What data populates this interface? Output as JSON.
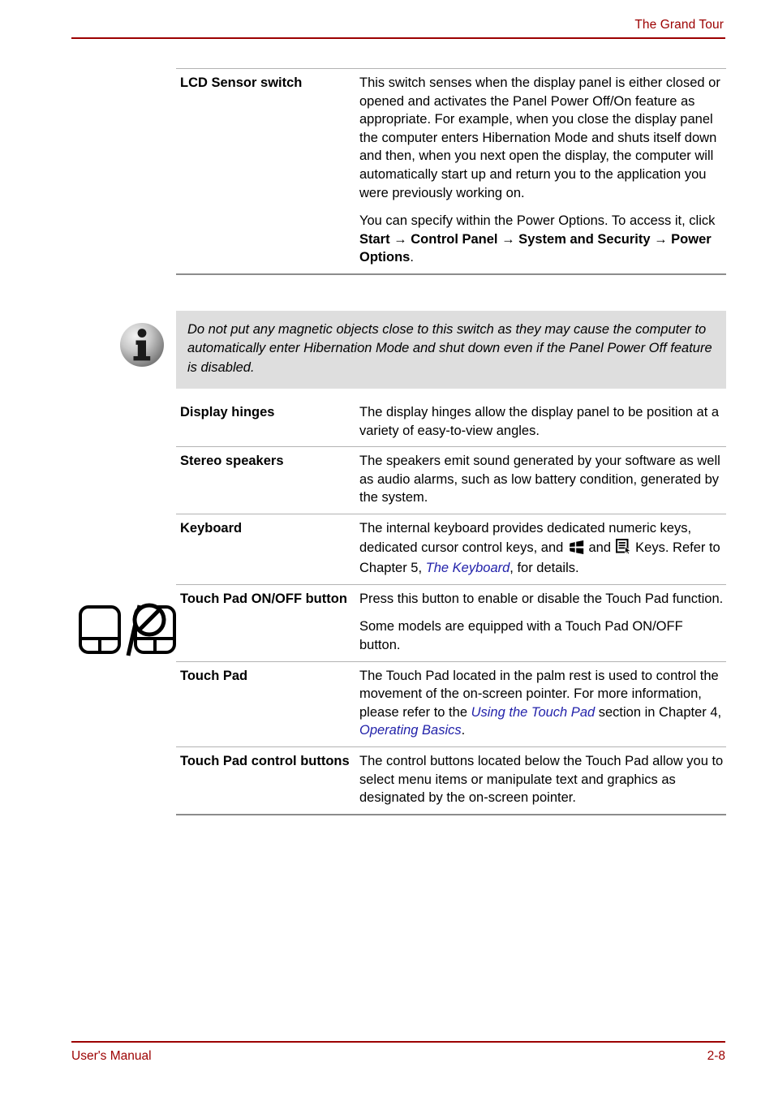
{
  "header": {
    "title": "The Grand Tour"
  },
  "footer": {
    "manual_label": "User's Manual",
    "page_number": "2-8"
  },
  "colors": {
    "accent_red": "#9c0000",
    "link_blue": "#2222aa",
    "note_background": "#dedede",
    "rule_gray": "#b3b3b3"
  },
  "table": {
    "rows": [
      {
        "term": "LCD Sensor switch",
        "paragraphs": [
          {
            "segments": [
              {
                "text": "This switch senses when the display panel is either closed or opened and activates the Panel Power Off/On feature as appropriate. For example, when you close the display panel the computer enters Hibernation Mode and shuts itself down and then, when you next open the display, the computer will automatically start up and return you to the application you were previously working on.",
                "style": "normal"
              }
            ]
          },
          {
            "segments": [
              {
                "text": "You can specify within the Power Options. To access it, click ",
                "style": "normal"
              },
              {
                "text": "Start → Control Panel → System and Security → Power Options",
                "style": "bold"
              },
              {
                "text": ".",
                "style": "normal"
              }
            ]
          }
        ]
      },
      {
        "term": "Display hinges",
        "paragraphs": [
          {
            "segments": [
              {
                "text": "The display hinges allow the display panel to be position at a variety of easy-to-view angles.",
                "style": "normal"
              }
            ]
          }
        ]
      },
      {
        "term": "Stereo speakers",
        "paragraphs": [
          {
            "segments": [
              {
                "text": "The speakers emit sound generated by your software as well as audio alarms, such as low battery condition, generated by the system.",
                "style": "normal"
              }
            ]
          }
        ]
      },
      {
        "term": "Keyboard",
        "paragraphs": [
          {
            "segments": [
              {
                "text": "The internal keyboard provides dedicated numeric keys, dedicated cursor control keys, and ",
                "style": "normal"
              },
              {
                "text": "",
                "style": "icon",
                "icon": "windows-key-icon"
              },
              {
                "text": " and ",
                "style": "normal"
              },
              {
                "text": "",
                "style": "icon",
                "icon": "application-key-icon"
              },
              {
                "text": "  Keys. Refer to Chapter 5, ",
                "style": "normal"
              },
              {
                "text": "The Keyboard",
                "style": "link"
              },
              {
                "text": ", for details.",
                "style": "normal"
              }
            ]
          }
        ]
      },
      {
        "term": "Touch Pad ON/OFF button",
        "margin_icon": "touchpad-on-off-icon",
        "paragraphs": [
          {
            "segments": [
              {
                "text": "Press this button to enable or disable the Touch Pad function.",
                "style": "normal"
              }
            ]
          },
          {
            "segments": [
              {
                "text": "Some models are equipped with a Touch Pad ON/OFF button.",
                "style": "normal"
              }
            ]
          }
        ]
      },
      {
        "term": "Touch Pad",
        "paragraphs": [
          {
            "segments": [
              {
                "text": "The Touch Pad located in the palm rest is used to control the movement of the on-screen pointer. For more information, please refer to the ",
                "style": "normal"
              },
              {
                "text": "Using the Touch Pad",
                "style": "link"
              },
              {
                "text": " section in Chapter 4, ",
                "style": "normal"
              },
              {
                "text": "Operating Basics",
                "style": "link"
              },
              {
                "text": ".",
                "style": "normal"
              }
            ]
          }
        ]
      },
      {
        "term": "Touch Pad control buttons",
        "paragraphs": [
          {
            "segments": [
              {
                "text": "The control buttons located below the Touch Pad allow you to select menu items or manipulate text and graphics as designated by the on-screen pointer.",
                "style": "normal"
              }
            ]
          }
        ]
      }
    ]
  },
  "note": {
    "icon": "info-icon",
    "text": "Do not put any magnetic objects close to this switch as they may cause the computer to automatically enter Hibernation Mode and shut down even if the Panel Power Off feature is disabled."
  }
}
